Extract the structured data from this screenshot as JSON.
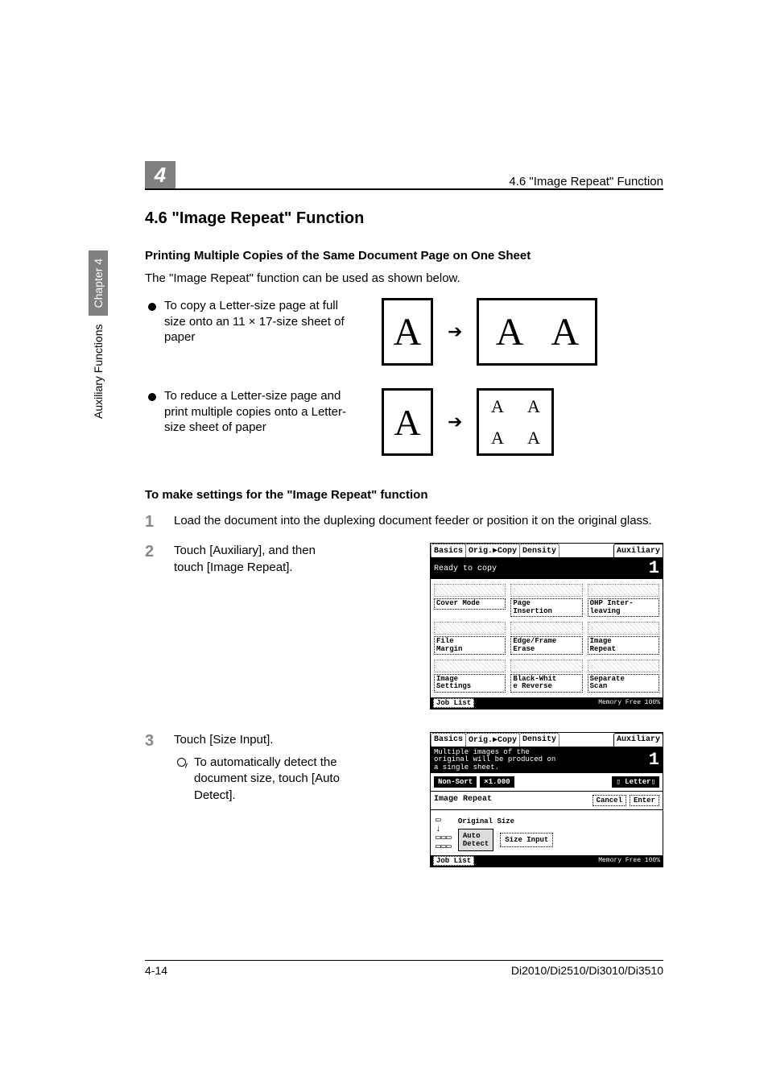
{
  "header": {
    "chapter_num": "4",
    "running_title": "4.6 \"Image Repeat\" Function"
  },
  "side": {
    "chapter_label": "Chapter 4",
    "section_label": "Auxiliary Functions"
  },
  "section": {
    "title": "4.6   \"Image Repeat\" Function",
    "subheading_1": "Printing Multiple Copies of the Same Document Page on One Sheet",
    "intro_text": "The \"Image Repeat\" function can be used as shown below.",
    "bullets": [
      "To copy a Letter-size page at full size onto an 11 × 17-size sheet of paper",
      "To reduce a Letter-size page and print multiple copies onto a Letter-size sheet of paper"
    ],
    "subheading_2": "To make settings for the \"Image Repeat\" function",
    "steps": {
      "s1": "Load the document into the duplexing document feeder or position it on the original glass.",
      "s2": "Touch [Auxiliary], and then touch [Image Repeat].",
      "s3": "Touch [Size Input].",
      "s3_sub": "To automatically detect the document size, touch [Auto Detect]."
    },
    "diagram_letters": {
      "A": "A"
    }
  },
  "lcd1": {
    "tabs": [
      "Basics",
      "Orig.▶Copy",
      "Density",
      "Auxiliary"
    ],
    "status": "Ready to copy",
    "count": "1",
    "buttons": [
      "Cover Mode",
      "Page\nInsertion",
      "OHP Inter-\nleaving",
      "File\nMargin",
      "Edge/Frame\nErase",
      "Image\nRepeat",
      "Image\nSettings",
      "Black-Whit\ne Reverse",
      "Separate\nScan"
    ],
    "job_list": "Job List",
    "memory": "Memory\nFree 100%"
  },
  "lcd2": {
    "tabs": [
      "Basics",
      "Orig.▶Copy",
      "Density",
      "Auxiliary"
    ],
    "msg": "Multiple images of the\noriginal will be produced on\na single sheet.",
    "count": "1",
    "row": {
      "nonsort": "Non-Sort",
      "zoom": "×1.000",
      "paper": "Letter"
    },
    "mode_label": "Image Repeat",
    "cancel": "Cancel",
    "enter": "Enter",
    "orig_size_label": "Original Size",
    "auto_detect": "Auto\nDetect",
    "size_input": "Size Input",
    "job_list": "Job List",
    "memory": "Memory\nFree 100%"
  },
  "footer": {
    "page": "4-14",
    "models": "Di2010/Di2510/Di3010/Di3510"
  }
}
